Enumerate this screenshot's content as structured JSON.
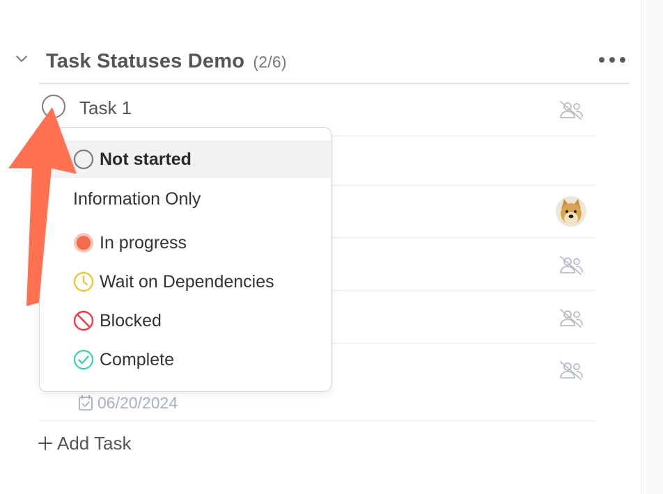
{
  "section": {
    "title": "Task Statuses Demo",
    "count": "(2/6)"
  },
  "task": {
    "title": "Task 1"
  },
  "status_menu": {
    "selected": "Not started",
    "info_option": "Information Only",
    "options": [
      {
        "label": "In progress",
        "icon": "in-progress-icon",
        "color": "#f36b4c"
      },
      {
        "label": "Wait on Dependencies",
        "icon": "clock-icon",
        "color": "#f2c12e"
      },
      {
        "label": "Blocked",
        "icon": "blocked-icon",
        "color": "#ea3b4a"
      },
      {
        "label": "Complete",
        "icon": "check-circle-icon",
        "color": "#3fcfb0"
      }
    ]
  },
  "due_date": "06/20/2024",
  "add_task": {
    "label": "Add Task"
  },
  "colors": {
    "arrow": "#ff7150",
    "muted_icon": "#b7bcc4"
  }
}
